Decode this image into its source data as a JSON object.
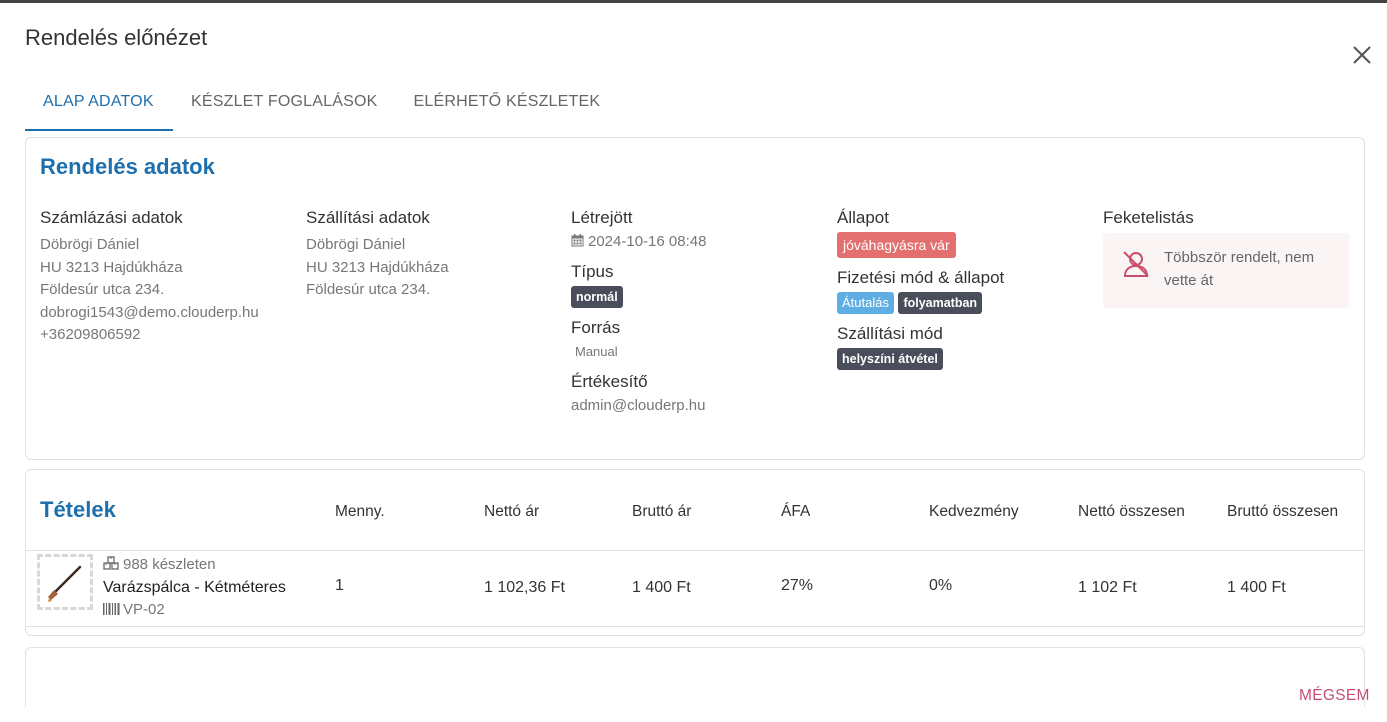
{
  "dialog": {
    "title": "Rendelés előnézet",
    "close_icon": "close-icon",
    "cancel_label": "MÉGSEM"
  },
  "tabs": [
    {
      "label": "ALAP ADATOK",
      "active": true
    },
    {
      "label": "KÉSZLET FOGLALÁSOK",
      "active": false
    },
    {
      "label": "ELÉRHETŐ KÉSZLETEK",
      "active": false
    }
  ],
  "order": {
    "title": "Rendelés adatok",
    "billing": {
      "heading": "Számlázási adatok",
      "name": "Döbrögi Dániel",
      "city": "HU 3213 Hajdúkháza",
      "street": "Földesúr utca 234.",
      "email": "dobrogi1543@demo.clouderp.hu",
      "phone": "+36209806592"
    },
    "shipping": {
      "heading": "Szállítási adatok",
      "name": "Döbrögi Dániel",
      "city": "HU 3213 Hajdúkháza",
      "street": "Földesúr utca 234."
    },
    "created": {
      "heading": "Létrejött",
      "value": "2024-10-16 08:48",
      "icon": "calendar-icon"
    },
    "type": {
      "heading": "Típus",
      "badge": "normál"
    },
    "source": {
      "heading": "Forrás",
      "value": "Manual"
    },
    "seller": {
      "heading": "Értékesítő",
      "value": "admin@clouderp.hu"
    },
    "status": {
      "heading": "Állapot",
      "badge": "jóváhagyásra vár"
    },
    "payment": {
      "heading": "Fizetési mód & állapot",
      "method": "Átutalás",
      "state": "folyamatban"
    },
    "delivery": {
      "heading": "Szállítási mód",
      "badge": "helyszíni átvétel"
    },
    "blacklist": {
      "heading": "Feketelistás",
      "text": "Többször rendelt, nem vette át",
      "icon": "user-blocked-icon"
    }
  },
  "items": {
    "title": "Tételek",
    "columns": [
      "Menny.",
      "Nettó ár",
      "Bruttó ár",
      "ÁFA",
      "Kedvezmény",
      "Nettó összesen",
      "Bruttó összesen"
    ],
    "rows": [
      {
        "stock": "988 készleten",
        "name": "Varázspálca - Kétméteres",
        "sku": "VP-02",
        "qty": "1",
        "net_price": "1 102,36 Ft",
        "gross_price": "1 400 Ft",
        "vat": "27%",
        "discount": "0%",
        "net_total": "1 102 Ft",
        "gross_total": "1 400 Ft"
      }
    ]
  },
  "colors": {
    "accent": "#1e6fae",
    "status_red": "#e3706f",
    "badge_dark": "#4a4d5a",
    "badge_blue": "#5faee3",
    "cancel": "#c64b79"
  }
}
